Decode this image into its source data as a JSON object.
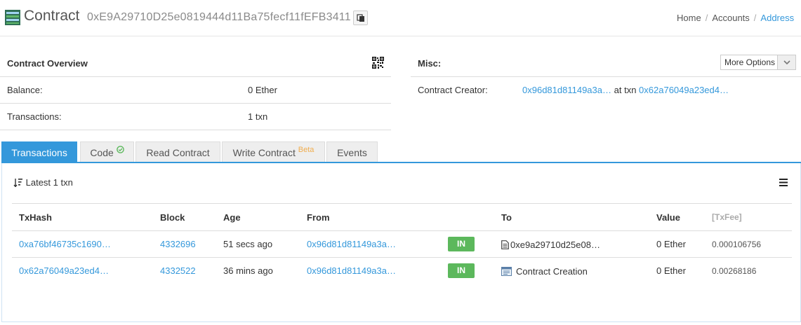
{
  "header": {
    "title": "Contract",
    "address": "0xE9A29710D25e0819444d11Ba75fecf11fEFB3411",
    "breadcrumb": [
      "Home",
      "Accounts",
      "Address"
    ]
  },
  "overview": {
    "heading": "Contract Overview",
    "balance_label": "Balance:",
    "balance_value": "0 Ether",
    "transactions_label": "Transactions:",
    "transactions_value": "1 txn"
  },
  "misc": {
    "heading": "Misc:",
    "more_options": "More Options",
    "creator_label": "Contract Creator:",
    "creator_address": "0x96d81d81149a3a…",
    "at_txn_text": "at txn",
    "creator_txn": "0x62a76049a23ed4…"
  },
  "tabs": [
    {
      "label": "Transactions"
    },
    {
      "label": "Code"
    },
    {
      "label": "Read Contract"
    },
    {
      "label": "Write Contract",
      "badge": "Beta"
    },
    {
      "label": "Events"
    }
  ],
  "latest_text": "Latest 1 txn",
  "table": {
    "headers": [
      "TxHash",
      "Block",
      "Age",
      "From",
      "",
      "To",
      "Value",
      "[TxFee]"
    ],
    "rows": [
      {
        "txhash": "0xa76bf46735c1690…",
        "block": "4332696",
        "age": "51 secs ago",
        "from": "0x96d81d81149a3a…",
        "direction": "IN",
        "to": "0xe9a29710d25e08…",
        "value": "0 Ether",
        "fee": "0.000106756"
      },
      {
        "txhash": "0x62a76049a23ed4…",
        "block": "4332522",
        "age": "36 mins ago",
        "from": "0x96d81d81149a3a…",
        "direction": "IN",
        "to": "Contract Creation",
        "value": "0 Ether",
        "fee": "0.00268186"
      }
    ]
  },
  "colors": {
    "accent": "#3498db",
    "in_badge": "#5cb85c",
    "beta": "#f0ad4e"
  }
}
